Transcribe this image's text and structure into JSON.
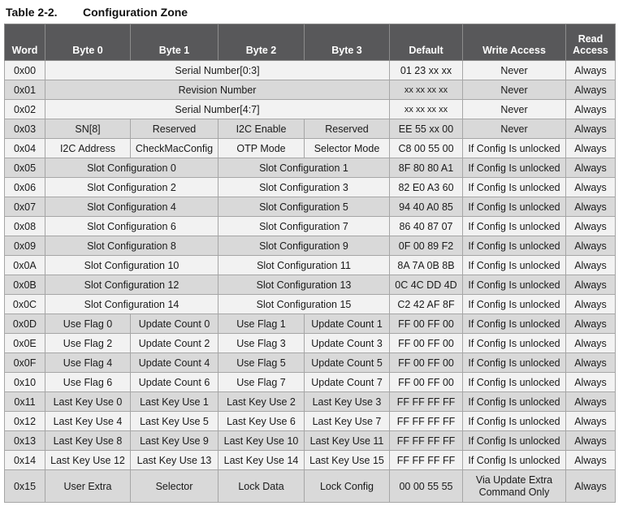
{
  "caption": {
    "number": "Table 2-2.",
    "title": "Configuration Zone"
  },
  "headers": {
    "word": "Word",
    "byte0": "Byte 0",
    "byte1": "Byte 1",
    "byte2": "Byte 2",
    "byte3": "Byte 3",
    "default": "Default",
    "write": "Write Access",
    "read_line1": "Read",
    "read_line2": "Access"
  },
  "rows": [
    {
      "word": "0x00",
      "span": "Serial Number[0:3]",
      "default": "01 23 xx xx",
      "write": "Never",
      "read": "Always"
    },
    {
      "word": "0x01",
      "span": "Revision Number",
      "default": "xx xx xx xx",
      "write": "Never",
      "read": "Always"
    },
    {
      "word": "0x02",
      "span": "Serial Number[4:7]",
      "default": "xx xx xx xx",
      "write": "Never",
      "read": "Always"
    },
    {
      "word": "0x03",
      "b0": "SN[8]",
      "b1": "Reserved",
      "b2": "I2C Enable",
      "b3": "Reserved",
      "default": "EE 55 xx 00",
      "write": "Never",
      "read": "Always"
    },
    {
      "word": "0x04",
      "b0": "I2C Address",
      "b1": "CheckMacConfig",
      "b2": "OTP Mode",
      "b3": "Selector Mode",
      "default": "C8 00 55 00",
      "write": "If Config Is unlocked",
      "read": "Always"
    },
    {
      "word": "0x05",
      "lo": "Slot Configuration 0",
      "hi": "Slot Configuration 1",
      "default": "8F 80 80 A1",
      "write": "If Config Is unlocked",
      "read": "Always"
    },
    {
      "word": "0x06",
      "lo": "Slot Configuration 2",
      "hi": "Slot Configuration 3",
      "default": "82 E0 A3 60",
      "write": "If Config Is unlocked",
      "read": "Always"
    },
    {
      "word": "0x07",
      "lo": "Slot Configuration 4",
      "hi": "Slot Configuration 5",
      "default": "94 40 A0 85",
      "write": "If Config Is unlocked",
      "read": "Always"
    },
    {
      "word": "0x08",
      "lo": "Slot Configuration 6",
      "hi": "Slot Configuration 7",
      "default": "86 40 87 07",
      "write": "If Config Is unlocked",
      "read": "Always"
    },
    {
      "word": "0x09",
      "lo": "Slot Configuration 8",
      "hi": "Slot Configuration 9",
      "default": "0F 00 89 F2",
      "write": "If Config Is unlocked",
      "read": "Always"
    },
    {
      "word": "0x0A",
      "lo": "Slot Configuration 10",
      "hi": "Slot Configuration 11",
      "default": "8A 7A 0B 8B",
      "write": "If Config Is unlocked",
      "read": "Always"
    },
    {
      "word": "0x0B",
      "lo": "Slot Configuration 12",
      "hi": "Slot Configuration 13",
      "default": "0C 4C DD 4D",
      "write": "If Config Is unlocked",
      "read": "Always"
    },
    {
      "word": "0x0C",
      "lo": "Slot Configuration 14",
      "hi": "Slot Configuration 15",
      "default": "C2 42 AF 8F",
      "write": "If Config Is unlocked",
      "read": "Always"
    },
    {
      "word": "0x0D",
      "b0": "Use Flag 0",
      "b1": "Update Count 0",
      "b2": "Use Flag 1",
      "b3": "Update Count 1",
      "default": "FF 00 FF 00",
      "write": "If Config Is unlocked",
      "read": "Always"
    },
    {
      "word": "0x0E",
      "b0": "Use Flag 2",
      "b1": "Update Count 2",
      "b2": "Use Flag 3",
      "b3": "Update Count 3",
      "default": "FF 00 FF 00",
      "write": "If Config Is unlocked",
      "read": "Always"
    },
    {
      "word": "0x0F",
      "b0": "Use Flag 4",
      "b1": "Update Count 4",
      "b2": "Use Flag 5",
      "b3": "Update Count 5",
      "default": "FF 00 FF 00",
      "write": "If Config Is unlocked",
      "read": "Always"
    },
    {
      "word": "0x10",
      "b0": "Use Flag 6",
      "b1": "Update Count 6",
      "b2": "Use Flag 7",
      "b3": "Update Count 7",
      "default": "FF 00 FF 00",
      "write": "If Config Is unlocked",
      "read": "Always"
    },
    {
      "word": "0x11",
      "b0": "Last Key Use 0",
      "b1": "Last Key Use 1",
      "b2": "Last Key Use 2",
      "b3": "Last Key Use 3",
      "default": "FF FF FF FF",
      "write": "If Config Is unlocked",
      "read": "Always"
    },
    {
      "word": "0x12",
      "b0": "Last Key Use 4",
      "b1": "Last Key Use 5",
      "b2": "Last Key Use 6",
      "b3": "Last Key Use 7",
      "default": "FF FF FF FF",
      "write": "If Config Is unlocked",
      "read": "Always"
    },
    {
      "word": "0x13",
      "b0": "Last Key Use 8",
      "b1": "Last Key Use 9",
      "b2": "Last Key Use 10",
      "b3": "Last Key Use 11",
      "default": "FF FF FF FF",
      "write": "If Config Is unlocked",
      "read": "Always"
    },
    {
      "word": "0x14",
      "b0": "Last Key Use 12",
      "b1": "Last Key Use 13",
      "b2": "Last Key Use 14",
      "b3": "Last Key Use 15",
      "default": "FF FF FF FF",
      "write": "If Config Is unlocked",
      "read": "Always"
    },
    {
      "word": "0x15",
      "b0": "User Extra",
      "b1": "Selector",
      "b2": "Lock Data",
      "b3": "Lock Config",
      "default": "00 00 55 55",
      "write": "Via Update Extra Command Only",
      "read": "Always"
    }
  ]
}
